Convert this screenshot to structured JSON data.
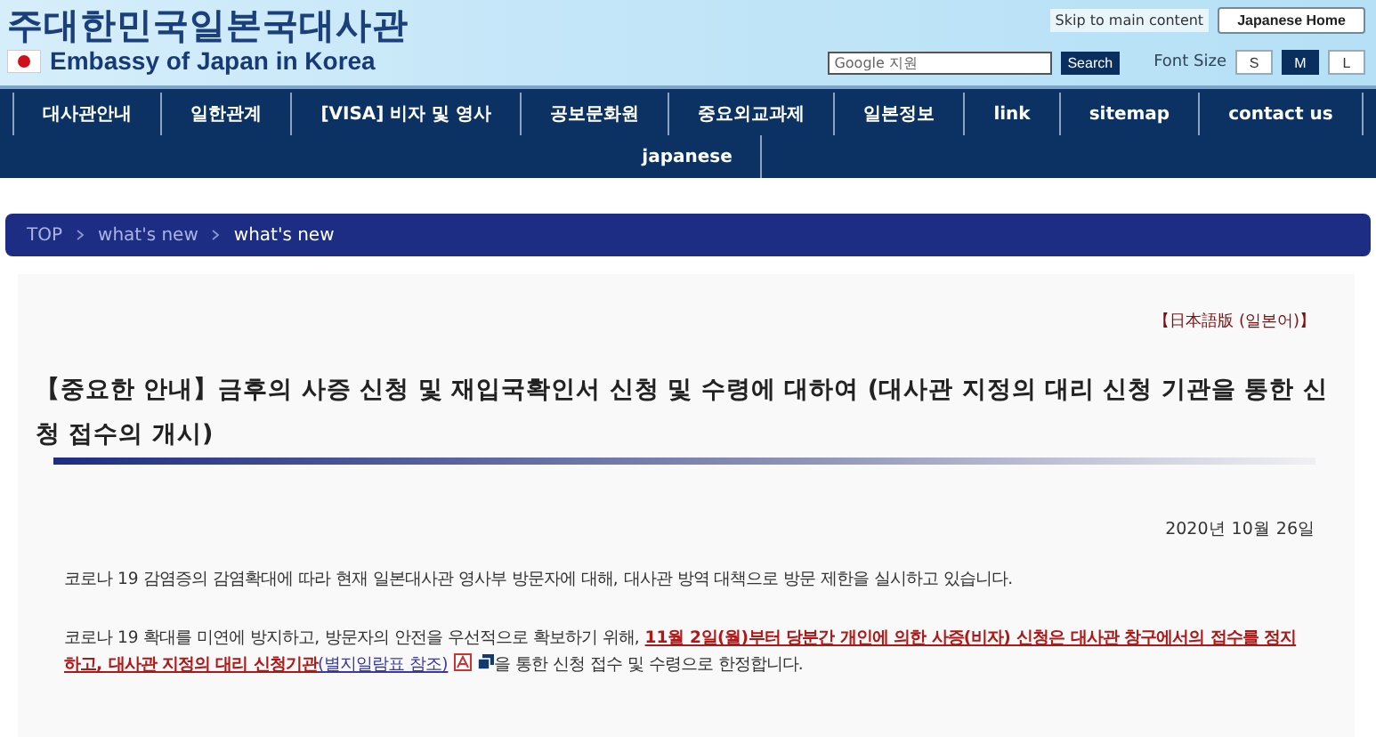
{
  "header": {
    "title": "주대한민국일본국대사관",
    "subtitle": "Embassy of Japan in Korea",
    "skip_link": "Skip to main content",
    "home_button": "Japanese Home",
    "search": {
      "placeholder": "Google 지원",
      "button": "Search"
    },
    "font_size": {
      "label": "Font Size",
      "options": [
        {
          "label": "S",
          "selected": false
        },
        {
          "label": "M",
          "selected": true
        },
        {
          "label": "L",
          "selected": false
        }
      ]
    }
  },
  "nav": {
    "items": [
      "대사관안내",
      "일한관계",
      "[VISA] 비자 및 영사",
      "공보문화원",
      "중요외교과제",
      "일본정보",
      "link",
      "sitemap",
      "contact us",
      "japanese"
    ]
  },
  "breadcrumb": [
    {
      "label": "TOP",
      "selected": false
    },
    {
      "label": "what's new",
      "selected": false
    },
    {
      "label": "what's new",
      "selected": true
    }
  ],
  "article": {
    "language_link": "【日本語版 (일본어)】",
    "title": "【중요한 안내】금후의 사증 신청 및 재입국확인서 신청 및 수령에 대하여 (대사관 지정의 대리 신청 기관을 통한 신청 접수의 개시)",
    "date": "2020년 10월 26일",
    "paragraphs": [
      [
        {
          "kind": "plain",
          "text": "코로나 19 감염증의 감염확대에 따라 현재 일본대사관 영사부 방문자에 대해, 대사관 방역 대책으로 방문 제한을 실시하고 있습니다."
        }
      ],
      [
        {
          "kind": "plain",
          "text": "코로나 19 확대를 미연에 방지하고, 방문자의 안전을 우선적으로 확보하기 위해, "
        },
        {
          "kind": "emphasis",
          "text": "11월 2일(월)부터 당분간 개인에 의한 사증(비자) 신청은 대사관 창구에서의 접수를 정지하고, 대사관 지정의 대리 신청기관"
        },
        {
          "kind": "link",
          "text": "(별지일람표 참조)"
        },
        {
          "kind": "pdf_icon"
        },
        {
          "kind": "window_icon"
        },
        {
          "kind": "plain",
          "text": "을 통한 신청 접수 및 수령으로 한정합니다."
        }
      ]
    ]
  }
}
